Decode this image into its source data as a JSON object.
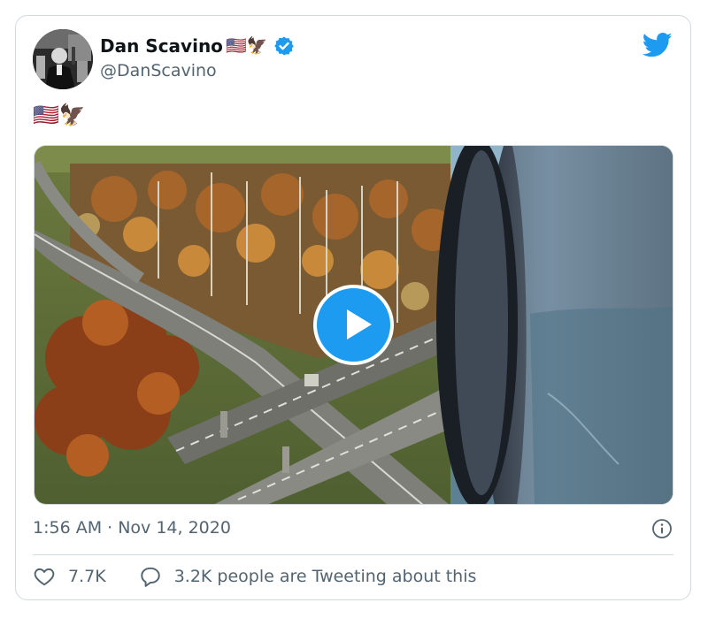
{
  "author": {
    "display_name": "Dan Scavino",
    "name_emoji": "🇺🇸🦅",
    "handle": "@DanScavino",
    "verified": true
  },
  "tweet": {
    "text": "🇺🇸🦅",
    "timestamp": "1:56 AM · Nov 14, 2020"
  },
  "media": {
    "type": "video",
    "scene": "aerial view from airplane window with jet engine over highway interchange and autumn trees"
  },
  "actions": {
    "likes": "7.7K",
    "conversation": "3.2K people are Tweeting about this"
  },
  "icons": {
    "brand": "twitter-bird-icon",
    "verified": "verified-badge-icon",
    "like": "heart-icon",
    "reply": "speech-bubble-icon",
    "info": "info-icon",
    "play": "play-icon"
  },
  "colors": {
    "accent": "#1d9bf0",
    "text": "#0f1419",
    "secondary_text": "#536471",
    "border": "#cfd9de"
  }
}
